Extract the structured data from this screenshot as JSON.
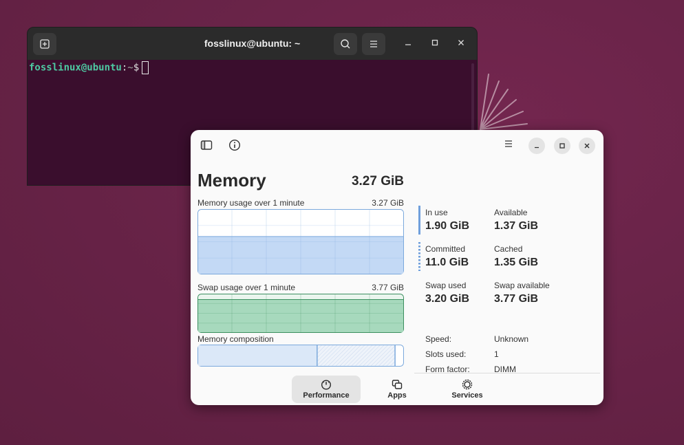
{
  "terminal": {
    "title": "fosslinux@ubuntu: ~",
    "prompt_user": "fosslinux@ubuntu",
    "prompt_sep": ":",
    "prompt_path": "~",
    "prompt_symbol": "$",
    "icons": {
      "new_tab": "new-tab-icon",
      "search": "search-icon",
      "menu": "hamburger-menu-icon",
      "minimize": "minimize-icon",
      "maximize": "maximize-icon",
      "close": "close-icon"
    }
  },
  "monitor": {
    "heading": "Memory",
    "total": "3.27 GiB",
    "graphs": {
      "memory_label": "Memory usage over 1 minute",
      "memory_value": "3.27 GiB",
      "memory_level": 0.58,
      "swap_label": "Swap usage over 1 minute",
      "swap_value": "3.77 GiB",
      "swap_level": 0.85,
      "composition_label": "Memory composition",
      "composition_in_use": 0.58,
      "composition_cached": 0.38
    },
    "stats": {
      "in_use_label": "In use",
      "in_use": "1.90 GiB",
      "available_label": "Available",
      "available": "1.37 GiB",
      "committed_label": "Committed",
      "committed": "11.0 GiB",
      "cached_label": "Cached",
      "cached": "1.35 GiB",
      "swap_used_label": "Swap used",
      "swap_used": "3.20 GiB",
      "swap_available_label": "Swap available",
      "swap_available": "3.77 GiB"
    },
    "info": {
      "speed_label": "Speed:",
      "speed": "Unknown",
      "slots_label": "Slots used:",
      "slots": "1",
      "form_label": "Form factor:",
      "form": "DIMM"
    },
    "nav": {
      "performance": "Performance",
      "apps": "Apps",
      "services": "Services"
    },
    "colors": {
      "memory_fill": "#c3d9f5",
      "memory_line": "#7aa8dc",
      "swap_fill": "#a7d9bd",
      "swap_line": "#3b8f5f",
      "accent_blue": "#6f9fdc"
    }
  }
}
